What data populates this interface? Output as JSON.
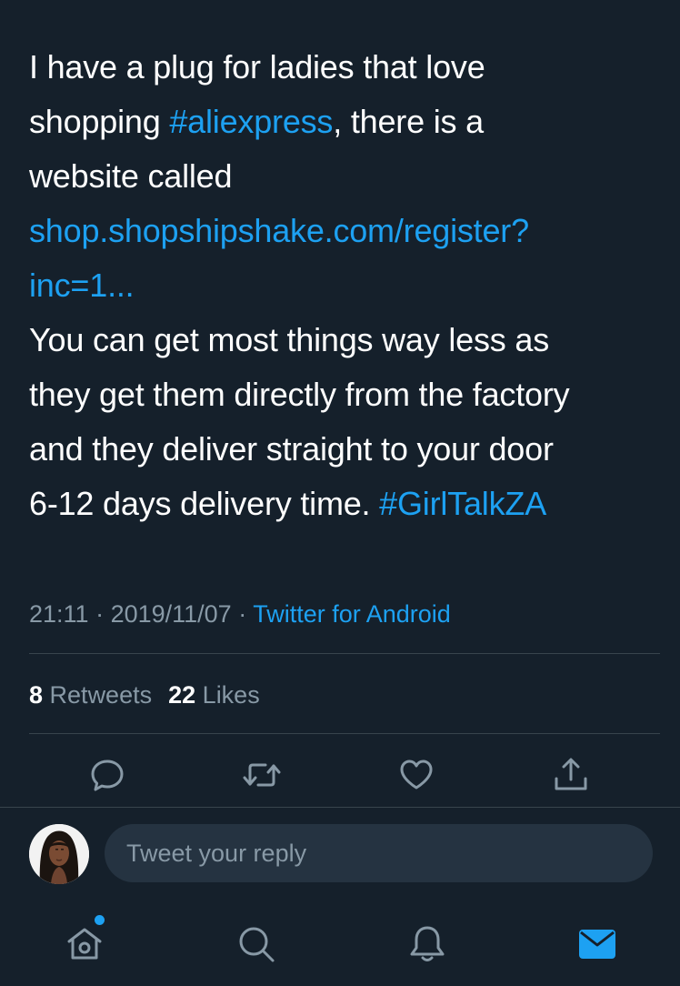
{
  "tweet": {
    "lines": [
      [
        {
          "text": "I have a plug for ladies that love",
          "link": false
        }
      ],
      [
        {
          "text": "shopping ",
          "link": false
        },
        {
          "text": "#aliexpress",
          "link": true
        },
        {
          "text": ", there is a",
          "link": false
        }
      ],
      [
        {
          "text": "website called",
          "link": false
        }
      ],
      [
        {
          "text": "shop.shopshipshake.com/register?",
          "link": true
        }
      ],
      [
        {
          "text": "inc=1...",
          "link": true
        }
      ],
      [
        {
          "text": "You can get most things way less as",
          "link": false
        }
      ],
      [
        {
          "text": "they get them directly from the factory",
          "link": false
        }
      ],
      [
        {
          "text": "and they deliver straight to your door",
          "link": false
        }
      ],
      [
        {
          "text": "6-12 days delivery time. ",
          "link": false
        },
        {
          "text": "#GirlTalkZA",
          "link": true
        }
      ]
    ],
    "time": "21:11",
    "separator": " · ",
    "date": "2019/11/07",
    "source": "Twitter for Android"
  },
  "stats": {
    "retweets_count": "8",
    "retweets_label": "Retweets",
    "likes_count": "22",
    "likes_label": "Likes"
  },
  "actions": [
    "reply-icon",
    "retweet-icon",
    "like-icon",
    "share-icon"
  ],
  "reply": {
    "placeholder": "Tweet your reply"
  },
  "tabbar": {
    "items": [
      "home-icon",
      "search-icon",
      "notifications-icon",
      "messages-icon"
    ],
    "active": "messages-icon"
  },
  "colors": {
    "background": "#15202b",
    "accent": "#1da1f2",
    "muted": "#8899a6",
    "divider": "#38444d",
    "input": "#253341"
  }
}
